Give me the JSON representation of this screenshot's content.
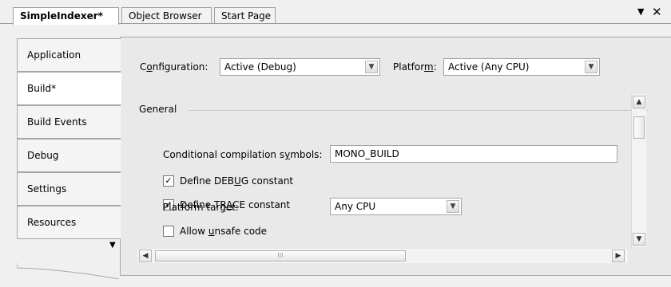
{
  "doc_tabs": [
    {
      "label": "SimpleIndexer*",
      "active": true
    },
    {
      "label": "Object Browser",
      "active": false
    },
    {
      "label": "Start Page",
      "active": false
    }
  ],
  "window_controls": {
    "dropdown_glyph": "▼",
    "close_glyph": "✕"
  },
  "side_tabs": [
    "Application",
    "Build*",
    "Build Events",
    "Debug",
    "Settings",
    "Resources"
  ],
  "side_more_glyph": "▼",
  "config": {
    "configuration_label_pre": "C",
    "configuration_label_ul": "o",
    "configuration_label_post": "nfiguration:",
    "configuration_value": "Active (Debug)",
    "platform_label_pre": "Platfor",
    "platform_label_ul": "m",
    "platform_label_post": ":",
    "platform_value": "Active (Any CPU)"
  },
  "section_general": "General",
  "symbols": {
    "label_pre": "Conditional compilation s",
    "label_ul": "y",
    "label_post": "mbols:",
    "value": "MONO_BUILD"
  },
  "checks": {
    "debug_pre": "Define DEB",
    "debug_ul": "U",
    "debug_post": "G constant",
    "debug_checked": true,
    "trace_pre": "Define TR",
    "trace_ul": "A",
    "trace_post": "CE constant",
    "trace_checked": true,
    "unsafe_pre": "Allow ",
    "unsafe_ul": "u",
    "unsafe_post": "nsafe code",
    "unsafe_checked": false
  },
  "platform_target": {
    "label_pre": "Platform tar",
    "label_ul": "g",
    "label_post": "et:",
    "value": "Any CPU"
  },
  "glyphs": {
    "check": "✓",
    "combo_arrow": "▼",
    "up": "▲",
    "down": "▼",
    "left": "◀",
    "right": "▶",
    "thumb_grip": "III"
  }
}
